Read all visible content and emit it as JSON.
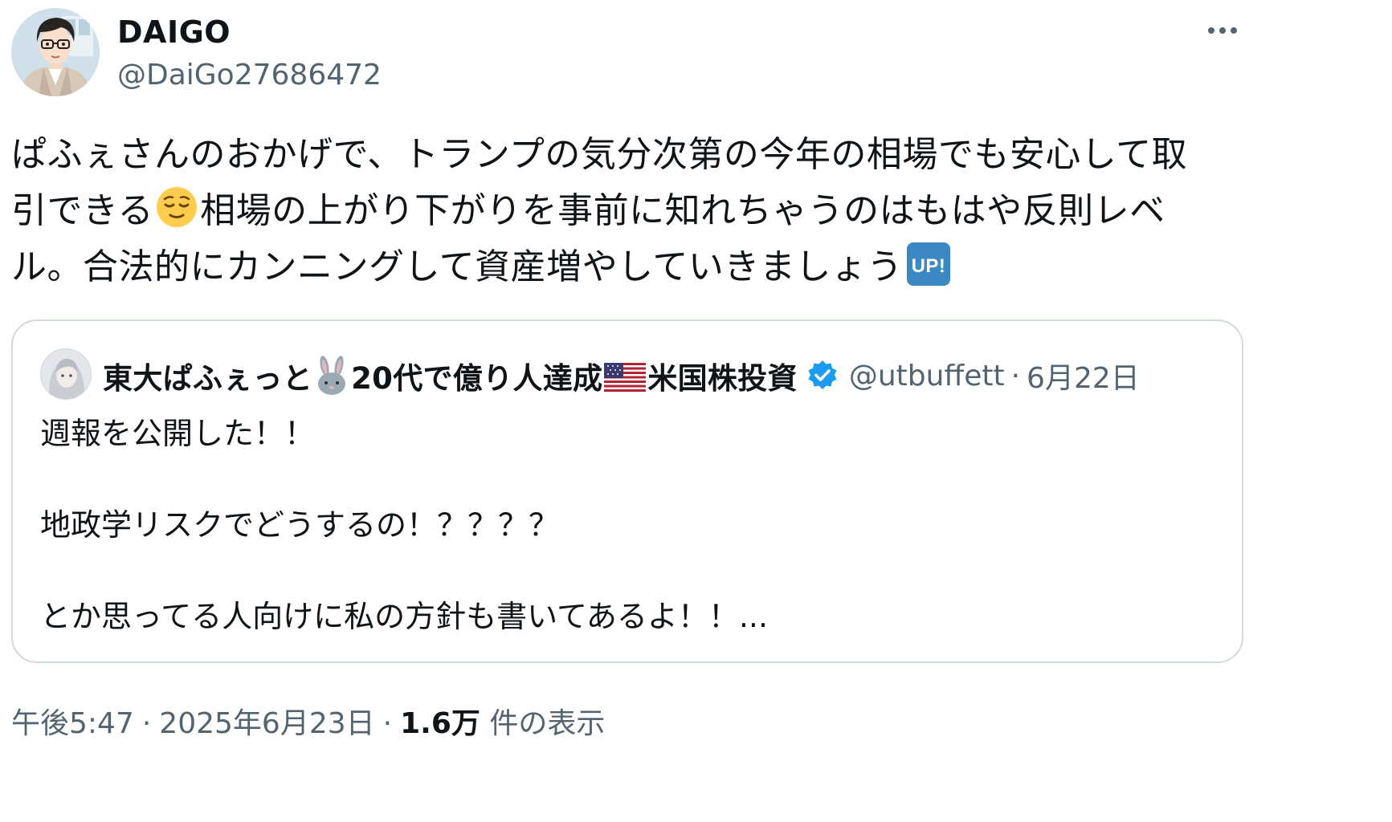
{
  "tweet": {
    "author": {
      "name": "DAIGO",
      "handle": "@DaiGo27686472"
    },
    "text_lines": [
      "ぱふぇさんのおかげで、トランプの気分次第の今年の相場でも安心して取",
      "引できる",
      "相場の上がり下がりを事前に知れちゃうのはもはや反則レベ",
      "ル。合法的にカンニングして資産増やしていきましょう"
    ],
    "emoji": {
      "relieved": "relieved-face-icon",
      "up": "up-button-icon",
      "up_text": "UP!"
    },
    "quote": {
      "name_part1": "東大ぱふぇっと",
      "name_part2": "20代で億り人達成",
      "name_part3": "米国株投資",
      "handle": "@utbuffett",
      "separator": "·",
      "date": "6月22日",
      "lines": [
        "週報を公開した！！",
        "",
        "地政学リスクでどうするの！？？？？",
        "",
        "とか思ってる人向けに私の方針も書いてあるよ！！..."
      ]
    },
    "meta": {
      "time": "午後5:47",
      "separator": "·",
      "date": "2025年6月23日",
      "views_count": "1.6万",
      "views_label": "件の表示"
    }
  },
  "colors": {
    "text": "#0f1419",
    "secondary": "#536471",
    "border": "#cfd9de",
    "verified": "#1d9bf0",
    "up_badge": "#3b88c3",
    "emoji_face": "#ffcc4d"
  }
}
